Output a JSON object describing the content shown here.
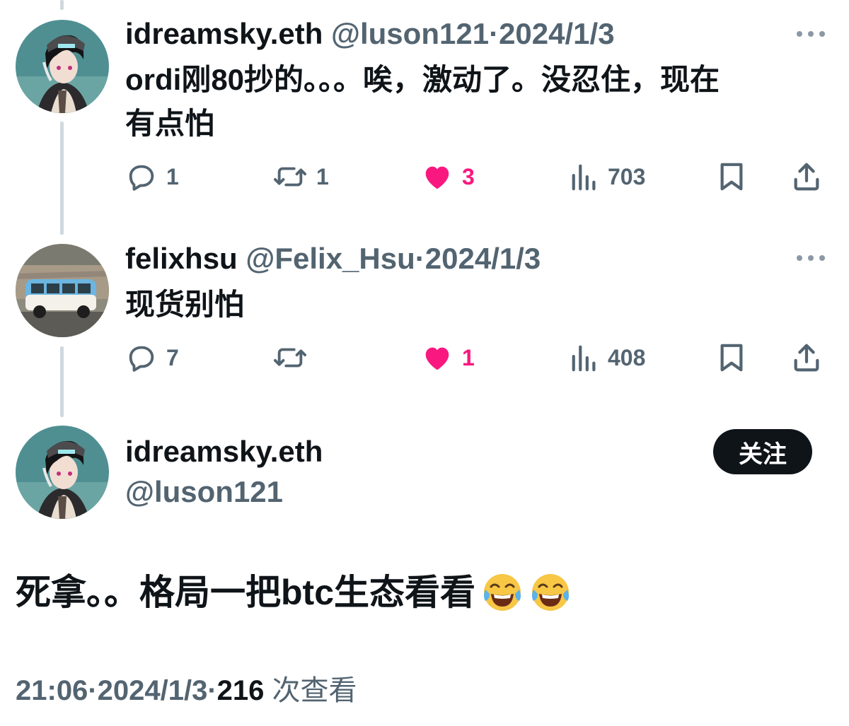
{
  "tweets": [
    {
      "name": "idreamsky.eth",
      "handle": "@luson121",
      "separator": "·",
      "date": "2024/1/3",
      "text_line1": "ordi刚80抄的。。。唉，激动了。没忍住，现在",
      "text_line2": "有点怕",
      "replies": "1",
      "reposts": "1",
      "likes": "3",
      "views": "703",
      "liked": true
    },
    {
      "name": "felixhsu",
      "handle": "@Felix_Hsu",
      "separator": "·",
      "date": "2024/1/3",
      "text_line1": "现货别怕",
      "replies": "7",
      "reposts": "",
      "likes": "1",
      "views": "408",
      "liked": true
    }
  ],
  "main_tweet": {
    "name": "idreamsky.eth",
    "handle": "@luson121",
    "follow_label": "关注",
    "text": "死拿。。格局一把btc生态看看",
    "emojis": [
      "face-with-tears-of-joy",
      "face-with-tears-of-joy"
    ],
    "time": "21:06",
    "separator": "·",
    "date": "2024/1/3",
    "views": "216",
    "views_label": "次查看"
  },
  "icons": {
    "reply": "reply-icon",
    "repost": "repost-icon",
    "like": "heart-icon",
    "views": "views-icon",
    "bookmark": "bookmark-icon",
    "share": "share-icon",
    "more": "more-icon"
  },
  "colors": {
    "text": "#0f1419",
    "muted": "#536471",
    "like": "#f91880",
    "thread_line": "#cfd9de",
    "follow_bg": "#0f1419"
  }
}
